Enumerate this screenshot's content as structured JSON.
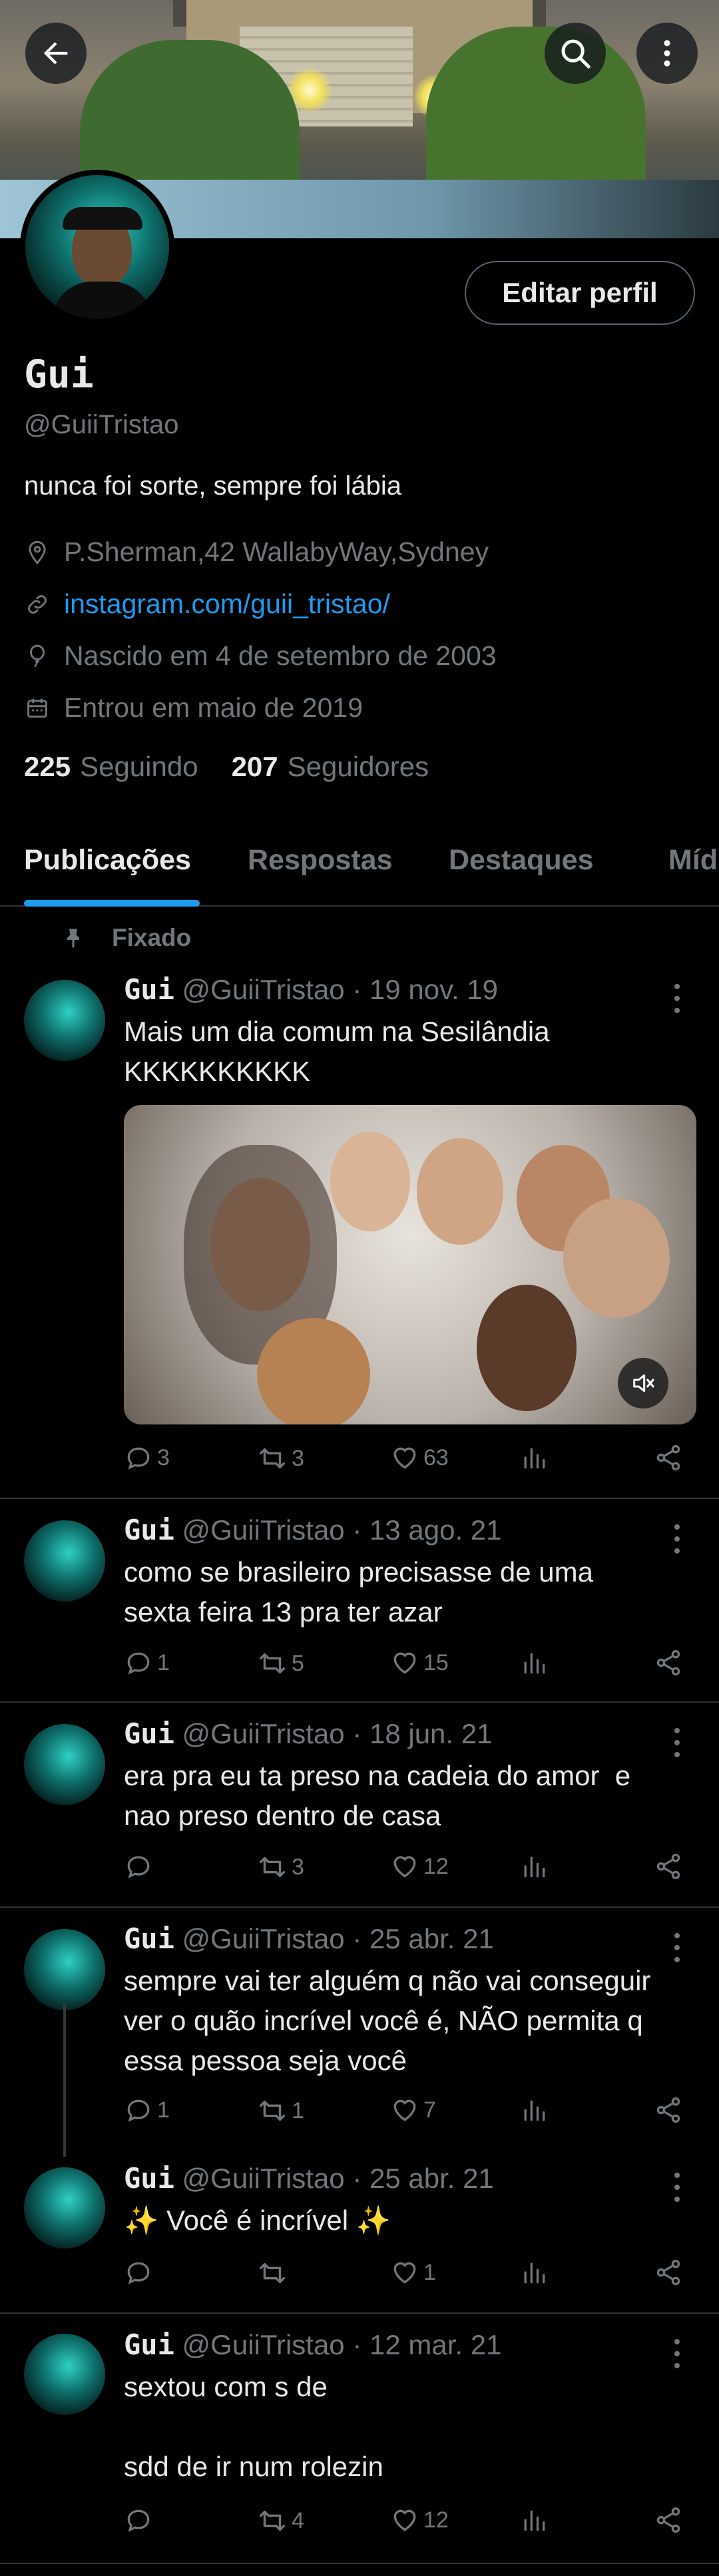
{
  "profile": {
    "name": "Gui",
    "handle": "@GuiiTristao",
    "bio": "nunca foi sorte, sempre foi lábia",
    "location": "P.Sherman,42 WallabyWay,Sydney",
    "link": "instagram.com/guii_tristao/",
    "birthday": "Nascido em 4 de setembro de 2003",
    "joined": "Entrou em maio de 2019",
    "following_count": "225",
    "following_label": "Seguindo",
    "followers_count": "207",
    "followers_label": "Seguidores",
    "edit_label": "Editar perfil"
  },
  "tabs": [
    "Publicações",
    "Respostas",
    "Destaques",
    "Míd"
  ],
  "pinned_label": "Fixado",
  "tweets": [
    {
      "name": "Gui",
      "handle": "@GuiiTristao",
      "date": "· 19 nov. 19",
      "text": "Mais um dia comum na Sesilândia\nKKKKKKKKKK",
      "replies": "3",
      "retweets": "3",
      "likes": "63"
    },
    {
      "name": "Gui",
      "handle": "@GuiiTristao",
      "date": "· 13 ago. 21",
      "text": "como se brasileiro precisasse de uma\nsexta feira 13 pra ter azar",
      "replies": "1",
      "retweets": "5",
      "likes": "15"
    },
    {
      "name": "Gui",
      "handle": "@GuiiTristao",
      "date": "· 18 jun. 21",
      "text": "era pra eu ta preso na cadeia do amor  e\nnao preso dentro de casa",
      "replies": "",
      "retweets": "3",
      "likes": "12"
    },
    {
      "name": "Gui",
      "handle": "@GuiiTristao",
      "date": "· 25 abr. 21",
      "text": "sempre vai ter alguém q não vai conseguir\nver o quão incrível você é, NÃO permita q\nessa pessoa seja você",
      "replies": "1",
      "retweets": "1",
      "likes": "7"
    },
    {
      "name": "Gui",
      "handle": "@GuiiTristao",
      "date": "· 25 abr. 21",
      "text": "✨ Você é incrível ✨",
      "replies": "",
      "retweets": "",
      "likes": "1"
    },
    {
      "name": "Gui",
      "handle": "@GuiiTristao",
      "date": "· 12 mar. 21",
      "text": "sextou com s de\n\nsdd de ir num rolezin",
      "replies": "",
      "retweets": "4",
      "likes": "12"
    }
  ],
  "icons": {
    "back": "arrow-left-icon",
    "search": "search-icon",
    "more": "more-vertical-icon",
    "location": "location-pin-icon",
    "link": "link-icon",
    "birthday": "balloon-icon",
    "calendar": "calendar-icon",
    "pin": "pin-icon",
    "reply": "reply-icon",
    "retweet": "retweet-icon",
    "like": "heart-icon",
    "views": "views-icon",
    "share": "share-icon",
    "mute": "volume-muted-icon"
  },
  "colors": {
    "accent": "#1d9bf0",
    "muted": "#71767b",
    "text": "#e7e9ea",
    "divider": "#2f3336"
  }
}
